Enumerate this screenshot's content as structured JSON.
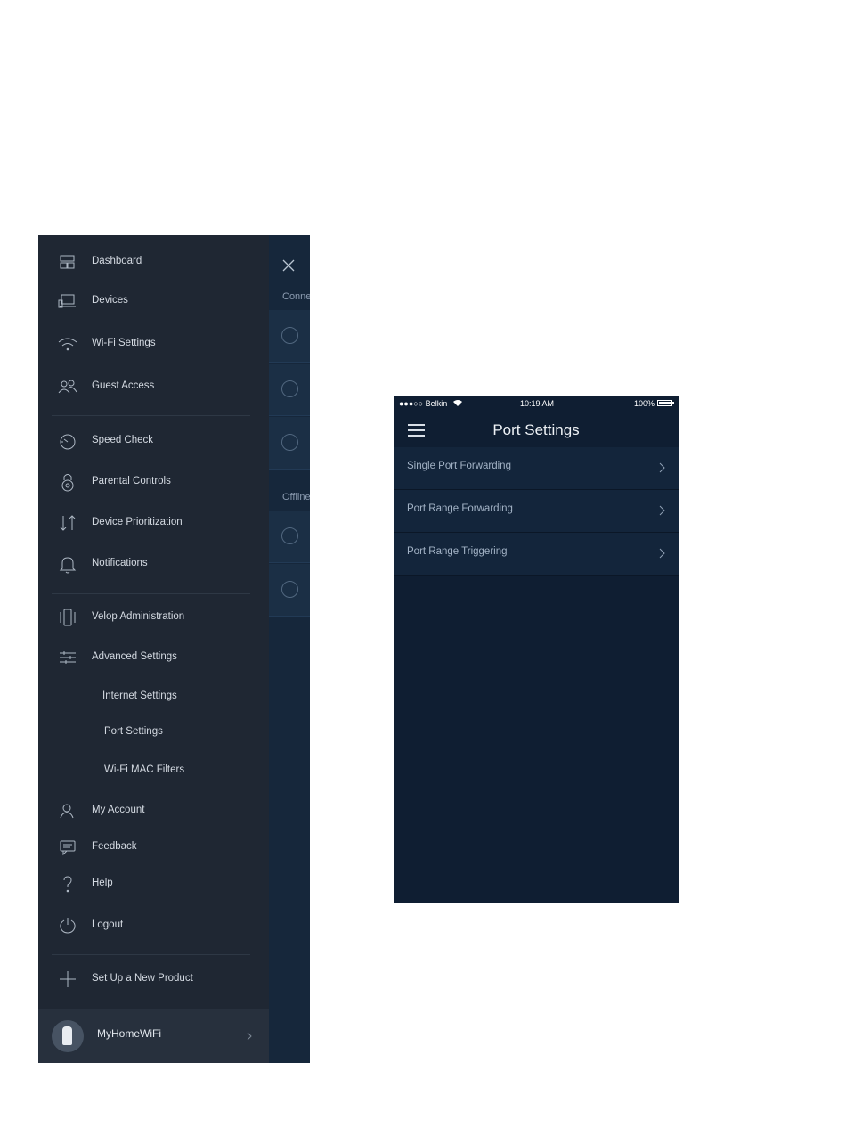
{
  "menu": {
    "items": [
      {
        "label": "Dashboard",
        "icon": "dashboard-icon"
      },
      {
        "label": "Devices",
        "icon": "devices-icon"
      },
      {
        "label": "Wi-Fi Settings",
        "icon": "wifi-icon"
      },
      {
        "label": "Guest Access",
        "icon": "guest-access-icon"
      },
      {
        "label": "Speed Check",
        "icon": "speed-check-icon"
      },
      {
        "label": "Parental Controls",
        "icon": "parental-controls-icon"
      },
      {
        "label": "Device Prioritization",
        "icon": "device-prioritization-icon"
      },
      {
        "label": "Notifications",
        "icon": "bell-icon"
      },
      {
        "label": "Velop Administration",
        "icon": "velop-admin-icon"
      },
      {
        "label": "Advanced Settings",
        "icon": "sliders-icon"
      }
    ],
    "advanced_sub": [
      "Internet Settings",
      "Port Settings",
      "Wi-Fi MAC Filters"
    ],
    "account_items": [
      {
        "label": "My Account",
        "icon": "user-icon"
      },
      {
        "label": "Feedback",
        "icon": "feedback-icon"
      },
      {
        "label": "Help",
        "icon": "help-icon"
      },
      {
        "label": "Logout",
        "icon": "power-icon"
      }
    ],
    "setup_label": "Set Up a New Product",
    "network_name": "MyHomeWiFi"
  },
  "behind_panel": {
    "connected_label": "Conne",
    "offline_label": "Offline"
  },
  "port_screen": {
    "status": {
      "carrier": "●●●○○ Belkin",
      "time": "10:19 AM",
      "battery": "100%"
    },
    "title": "Port Settings",
    "rows": [
      "Single Port Forwarding",
      "Port Range Forwarding",
      "Port Range Triggering"
    ]
  },
  "colors": {
    "menu_bg": "#1f2733",
    "menu_footer_bg": "#27303d",
    "behind_bg": "#16273b",
    "port_bg": "#0f1e32",
    "port_row_bg": "#13253b",
    "menu_text": "#d4dae2"
  }
}
